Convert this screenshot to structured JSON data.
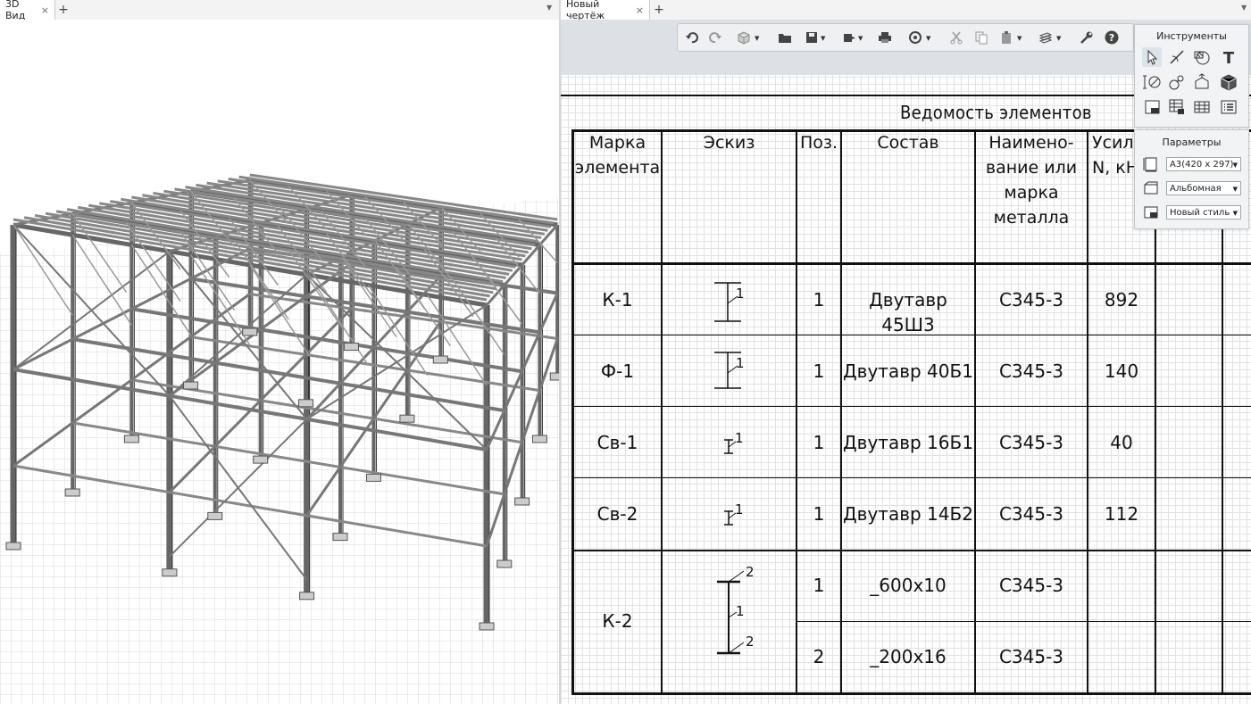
{
  "left_tab": {
    "label": "3D Вид",
    "close": "×",
    "add": "+"
  },
  "right_tab": {
    "label": "Новый чертёж",
    "close": "×",
    "add": "+"
  },
  "table": {
    "title": "Ведомость элементов",
    "headers": [
      "Марка элемента",
      "Эскиз",
      "Поз.",
      "Состав",
      "Наимено-вание или марка металла",
      "Усили N, кН"
    ],
    "rows": [
      {
        "mark": "К-1",
        "pos": [
          "1"
        ],
        "composition": [
          "Двутавр 45Ш3"
        ],
        "steel": "С345-3",
        "force": "892",
        "sketch_labels": [
          "1"
        ]
      },
      {
        "mark": "Ф-1",
        "pos": [
          "1"
        ],
        "composition": [
          "Двутавр 40Б1"
        ],
        "steel": "С345-3",
        "force": "140",
        "sketch_labels": [
          "1"
        ]
      },
      {
        "mark": "Св-1",
        "pos": [
          "1"
        ],
        "composition": [
          "Двутавр 16Б1"
        ],
        "steel": "С345-3",
        "force": "40",
        "sketch_labels": [
          "1"
        ]
      },
      {
        "mark": "Св-2",
        "pos": [
          "1"
        ],
        "composition": [
          "Двутавр 14Б2"
        ],
        "steel": "С345-3",
        "force": "112",
        "sketch_labels": [
          "1"
        ]
      },
      {
        "mark": "К-2",
        "pos": [
          "1",
          "2"
        ],
        "composition": [
          "_600x10",
          "_200x16"
        ],
        "steel": [
          "С345-3",
          "С345-3"
        ],
        "force": "",
        "sketch_labels": [
          "2",
          "1",
          "2"
        ]
      }
    ]
  },
  "tools_panel": {
    "title": "Инструменты",
    "icons": [
      "pointer-icon",
      "line-icon",
      "hatch-icon",
      "text-icon",
      "dimension-icon",
      "node-icon",
      "extrude-icon",
      "box-icon",
      "title-block-icon",
      "table-edit-icon",
      "table-icon",
      "list-icon"
    ]
  },
  "params_panel": {
    "title": "Параметры",
    "sheet_format": "А3(420 x 297)",
    "orientation": "Альбомная",
    "style": "Новый стиль"
  },
  "toolbar_icons": [
    "undo-icon",
    "redo-icon",
    "view-cube-icon",
    "open-folder-icon",
    "save-icon",
    "export-icon",
    "print-icon",
    "snap-icon",
    "cut-icon",
    "copy-icon",
    "paste-icon",
    "layers-icon",
    "settings-wrench-icon",
    "help-icon"
  ],
  "colors": {
    "grid": "#e2e2e2",
    "toolbar_bg": "#dde1e6",
    "table_line": "#111111"
  }
}
